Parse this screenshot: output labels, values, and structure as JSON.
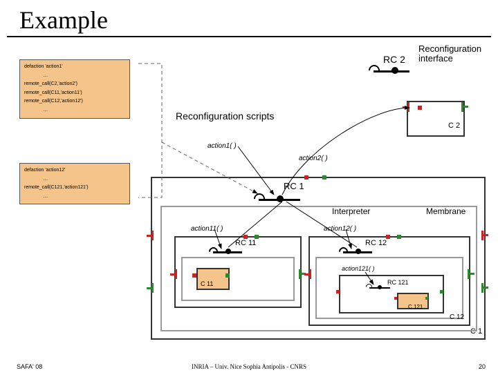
{
  "title": "Example",
  "reconfig_interface_label": "Reconfiguration interface",
  "reconfig_scripts_label": "Reconfiguration scripts",
  "interpreter_label": "Interpreter",
  "membrane_label": "Membrane",
  "scripts": {
    "box1": {
      "line1": "defaction 'action1'",
      "line2": "              …",
      "line3": "remote_call(C2,'action2')",
      "line4": "remote_call(C11,'action11')",
      "line5": "remote_call(C12,'action12')",
      "line6": "              …"
    },
    "box2": {
      "line1": "defaction 'action12'",
      "line2": "              …",
      "line3": "remote_call(C121,'action121')",
      "line4": "              …"
    }
  },
  "rc": {
    "rc2": "RC 2",
    "rc1": "RC 1",
    "rc11": "RC 11",
    "rc12": "RC 12",
    "rc121": "RC 121"
  },
  "c": {
    "c1": "C 1",
    "c2": "C 2",
    "c11": "C 11",
    "c12": "C 12",
    "c121": "C 121"
  },
  "actions": {
    "a1": "action1( )",
    "a2": "action2( )",
    "a11": "action11( )",
    "a12": "action12( )",
    "a121": "action121( )"
  },
  "footer": {
    "left": "SAFA' 08",
    "center": "INRIA – Univ. Nice Sophia Antipolis - CNRS",
    "right": "20"
  }
}
